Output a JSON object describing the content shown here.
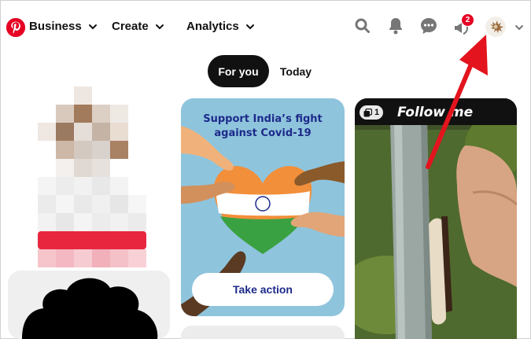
{
  "header": {
    "nav": [
      {
        "label": "Business"
      },
      {
        "label": "Create"
      },
      {
        "label": "Analytics"
      }
    ],
    "notification_count": "2"
  },
  "tabs": [
    {
      "label": "For you",
      "active": true
    },
    {
      "label": "Today",
      "active": false
    }
  ],
  "pins": {
    "covid": {
      "title_line1": "Support India’s fight",
      "title_line2": "against Covid-19",
      "button": "Take action"
    },
    "follow": {
      "title": "Follow me",
      "count": "1"
    }
  },
  "colors": {
    "brand": "#e60023",
    "covid_bg": "#8fc4dd",
    "covid_text": "#1d2a8a",
    "annotation": "#e3141d"
  },
  "icons": [
    "pinterest-logo-icon",
    "chevron-down-icon",
    "search-icon",
    "bell-icon",
    "messages-icon",
    "updates-megaphone-icon",
    "multi-image-icon"
  ]
}
